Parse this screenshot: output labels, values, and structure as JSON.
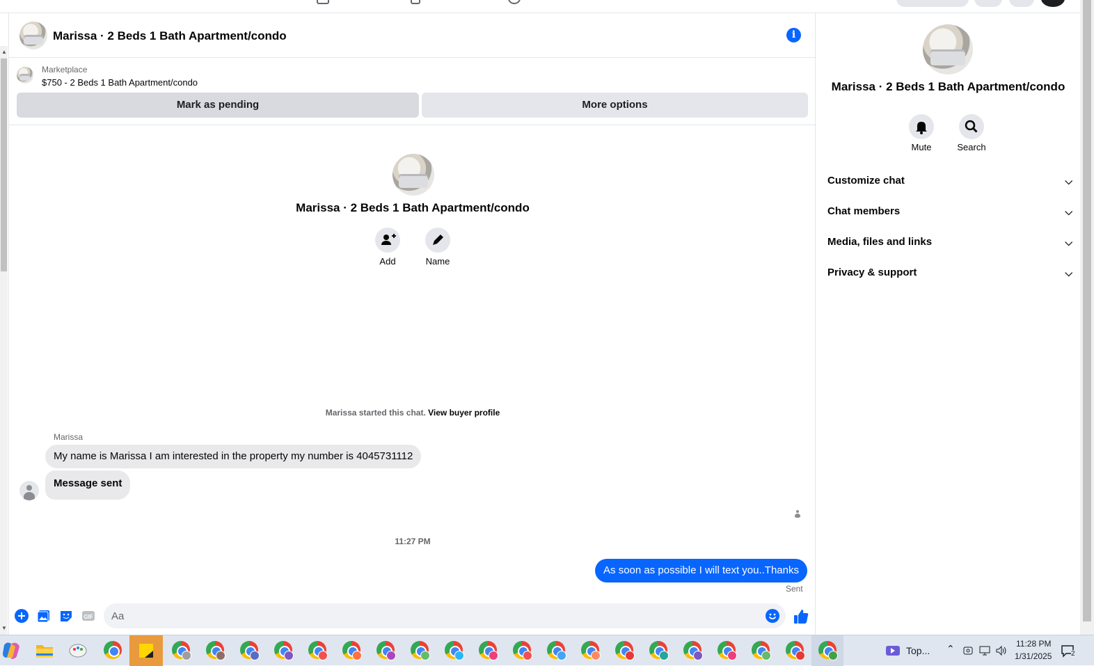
{
  "header": {
    "title": "Marissa · 2 Beds 1 Bath Apartment/condo",
    "info_icon": "i"
  },
  "marketplace": {
    "label": "Marketplace",
    "listing": "$750 - 2 Beds 1 Bath Apartment/condo",
    "mark_pending": "Mark as pending",
    "more_options": "More options"
  },
  "intro": {
    "title": "Marissa · 2 Beds 1 Bath Apartment/condo",
    "add_label": "Add",
    "name_label": "Name",
    "started_text": "Marissa started this chat.",
    "view_profile": "View buyer profile"
  },
  "messages": {
    "sender": "Marissa",
    "incoming": [
      "My name is Marissa I am interested in the property my number is 4045731112",
      "Message sent"
    ],
    "timestamp": "11:27 PM",
    "outgoing": "As soon as possible I will text you..Thanks",
    "status": "Sent"
  },
  "composer": {
    "placeholder": "Aa",
    "value": ""
  },
  "side": {
    "title": "Marissa · 2 Beds 1 Bath Apartment/condo",
    "mute_label": "Mute",
    "search_label": "Search",
    "sections": [
      {
        "label": "Customize chat"
      },
      {
        "label": "Chat members"
      },
      {
        "label": "Media, files and links"
      },
      {
        "label": "Privacy & support"
      }
    ]
  },
  "taskbar": {
    "widget_label": "Top...",
    "time": "11:28 PM",
    "date": "1/31/2025",
    "notification_count": "2"
  },
  "colors": {
    "accent": "#0866ff",
    "bubble_in": "#e9e9eb",
    "button_bg": "#e4e6eb"
  }
}
